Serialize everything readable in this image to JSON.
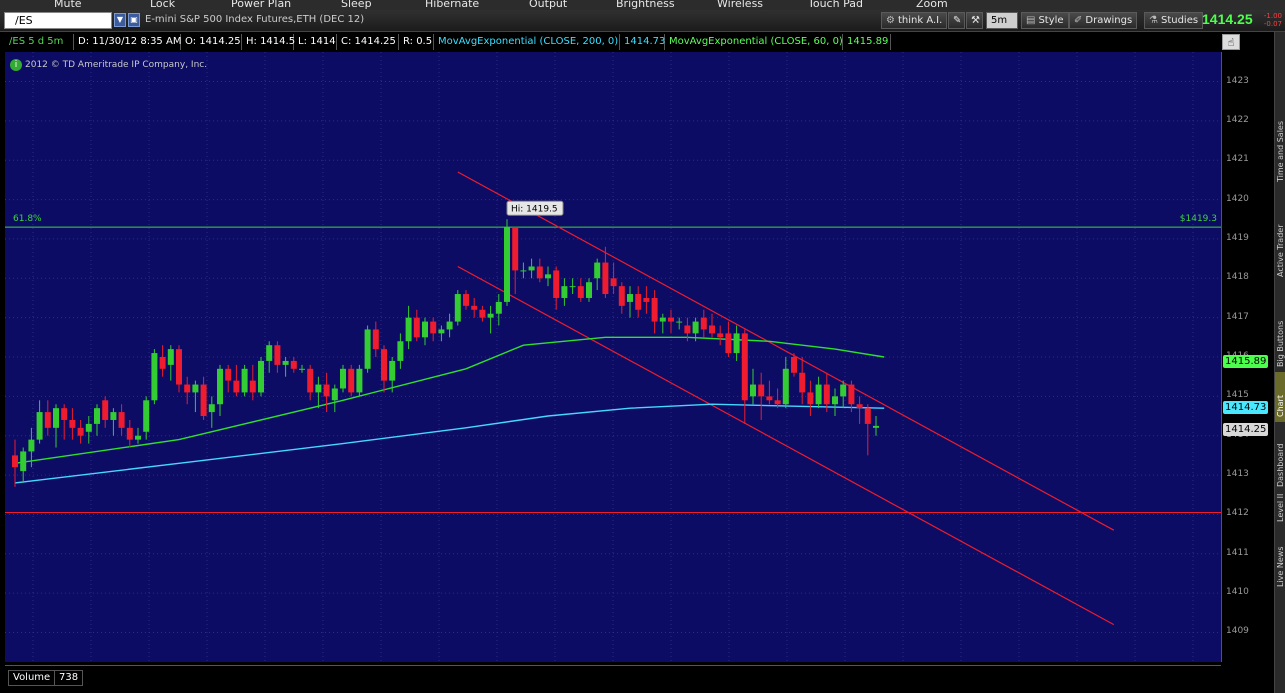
{
  "media_keys": [
    "Mute",
    "Lock",
    "Power Plan",
    "Sleep",
    "Hibernate",
    "Output",
    "Brightness",
    "Wireless",
    "Touch Pad",
    "Zoom"
  ],
  "toolbar": {
    "symbol": "/ES",
    "description": "E-mini S&P 500 Index Futures,ETH (DEC 12)",
    "think_ai": "think A.I.",
    "timeframe": "5m",
    "style": "Style",
    "drawings": "Drawings",
    "studies": "Studies",
    "last_price": "1414.25",
    "change_top": "-1.00",
    "change_bottom": "-0.07"
  },
  "legend": {
    "symbol": "/ES 5 d 5m",
    "date": "D: 11/30/12 8:35 AM",
    "open": "O: 1414.25",
    "high": "H: 1414.5",
    "low": "L: 1414",
    "close": "C: 1414.25",
    "range": "R: 0.5",
    "ema200_label": "MovAvgExponential (CLOSE, 200, 0)",
    "ema200_value": "1414.73",
    "ema60_label": "MovAvgExponential (CLOSE, 60, 0)",
    "ema60_value": "1415.89"
  },
  "copyright": "2012 © TD Ameritrade IP Company, Inc.",
  "fib": {
    "label": "61.8%",
    "price_label": "$1419.3",
    "price": 1419.3
  },
  "hi_label": "Hi: 1419.5",
  "support_line": 1412.05,
  "y_axis_labels": [
    "1423",
    "1422",
    "1421",
    "1420",
    "1419",
    "1418",
    "1417",
    "1416",
    "1415",
    "1414",
    "1413",
    "1412",
    "1411",
    "1410",
    "1409"
  ],
  "price_tags": {
    "ema60": "1415.89",
    "ema200": "1414.73",
    "last": "1414.25"
  },
  "side_tabs": [
    "Time and Sales",
    "Active Trader",
    "Big Buttons",
    "Chart",
    "Dashboard",
    "Level II",
    "Live News"
  ],
  "volume": {
    "label": "Volume",
    "value": "738"
  },
  "colors": {
    "background": "#0c0c64",
    "up": "#33cc33",
    "down": "#ee1c2e",
    "ema60": "#2ee02e",
    "ema200": "#45d8ff",
    "channel": "#ee1c2e"
  },
  "chart_data": {
    "type": "candlestick",
    "ylim": [
      1408.25,
      1423.75
    ],
    "interval": "5m",
    "candles": [
      {
        "o": 1413.5,
        "h": 1413.9,
        "l": 1412.7,
        "c": 1413.2
      },
      {
        "o": 1413.1,
        "h": 1413.7,
        "l": 1412.8,
        "c": 1413.6
      },
      {
        "o": 1413.6,
        "h": 1414.2,
        "l": 1413.2,
        "c": 1413.9
      },
      {
        "o": 1413.9,
        "h": 1414.9,
        "l": 1413.8,
        "c": 1414.6
      },
      {
        "o": 1414.6,
        "h": 1414.9,
        "l": 1414.0,
        "c": 1414.2
      },
      {
        "o": 1414.2,
        "h": 1414.8,
        "l": 1413.7,
        "c": 1414.7
      },
      {
        "o": 1414.7,
        "h": 1414.8,
        "l": 1413.9,
        "c": 1414.4
      },
      {
        "o": 1414.4,
        "h": 1414.7,
        "l": 1413.9,
        "c": 1414.2
      },
      {
        "o": 1414.2,
        "h": 1414.4,
        "l": 1413.8,
        "c": 1414.0
      },
      {
        "o": 1414.1,
        "h": 1414.5,
        "l": 1413.8,
        "c": 1414.3
      },
      {
        "o": 1414.3,
        "h": 1414.8,
        "l": 1414.0,
        "c": 1414.7
      },
      {
        "o": 1414.9,
        "h": 1415.0,
        "l": 1414.2,
        "c": 1414.4
      },
      {
        "o": 1414.4,
        "h": 1414.7,
        "l": 1414.0,
        "c": 1414.6
      },
      {
        "o": 1414.6,
        "h": 1414.8,
        "l": 1414.0,
        "c": 1414.2
      },
      {
        "o": 1414.2,
        "h": 1414.4,
        "l": 1413.7,
        "c": 1413.9
      },
      {
        "o": 1413.9,
        "h": 1414.2,
        "l": 1413.8,
        "c": 1414.0
      },
      {
        "o": 1414.1,
        "h": 1415.0,
        "l": 1413.9,
        "c": 1414.9
      },
      {
        "o": 1414.9,
        "h": 1416.2,
        "l": 1414.8,
        "c": 1416.1
      },
      {
        "o": 1416.0,
        "h": 1416.3,
        "l": 1415.5,
        "c": 1415.7
      },
      {
        "o": 1415.8,
        "h": 1416.3,
        "l": 1415.4,
        "c": 1416.2
      },
      {
        "o": 1416.2,
        "h": 1416.3,
        "l": 1415.1,
        "c": 1415.3
      },
      {
        "o": 1415.3,
        "h": 1415.5,
        "l": 1414.8,
        "c": 1415.1
      },
      {
        "o": 1415.1,
        "h": 1415.4,
        "l": 1414.6,
        "c": 1415.3
      },
      {
        "o": 1415.3,
        "h": 1415.5,
        "l": 1414.4,
        "c": 1414.5
      },
      {
        "o": 1414.6,
        "h": 1415.0,
        "l": 1414.2,
        "c": 1414.8
      },
      {
        "o": 1414.8,
        "h": 1415.8,
        "l": 1414.5,
        "c": 1415.7
      },
      {
        "o": 1415.7,
        "h": 1415.8,
        "l": 1415.1,
        "c": 1415.4
      },
      {
        "o": 1415.4,
        "h": 1415.8,
        "l": 1415.0,
        "c": 1415.1
      },
      {
        "o": 1415.1,
        "h": 1415.8,
        "l": 1415.0,
        "c": 1415.7
      },
      {
        "o": 1415.4,
        "h": 1415.8,
        "l": 1414.9,
        "c": 1415.1
      },
      {
        "o": 1415.1,
        "h": 1416.0,
        "l": 1415.0,
        "c": 1415.9
      },
      {
        "o": 1415.9,
        "h": 1416.4,
        "l": 1415.6,
        "c": 1416.3
      },
      {
        "o": 1416.3,
        "h": 1416.4,
        "l": 1415.6,
        "c": 1415.8
      },
      {
        "o": 1415.8,
        "h": 1416.0,
        "l": 1415.5,
        "c": 1415.9
      },
      {
        "o": 1415.9,
        "h": 1416.0,
        "l": 1415.6,
        "c": 1415.7
      },
      {
        "o": 1415.7,
        "h": 1415.8,
        "l": 1415.6,
        "c": 1415.7
      },
      {
        "o": 1415.7,
        "h": 1415.8,
        "l": 1414.9,
        "c": 1415.1
      },
      {
        "o": 1415.1,
        "h": 1415.5,
        "l": 1414.7,
        "c": 1415.3
      },
      {
        "o": 1415.3,
        "h": 1415.6,
        "l": 1414.6,
        "c": 1415.0
      },
      {
        "o": 1414.9,
        "h": 1415.3,
        "l": 1414.6,
        "c": 1415.2
      },
      {
        "o": 1415.2,
        "h": 1415.8,
        "l": 1415.1,
        "c": 1415.7
      },
      {
        "o": 1415.7,
        "h": 1415.8,
        "l": 1415.0,
        "c": 1415.1
      },
      {
        "o": 1415.1,
        "h": 1415.8,
        "l": 1415.0,
        "c": 1415.7
      },
      {
        "o": 1415.7,
        "h": 1416.8,
        "l": 1415.6,
        "c": 1416.7
      },
      {
        "o": 1416.7,
        "h": 1416.9,
        "l": 1416.0,
        "c": 1416.2
      },
      {
        "o": 1416.2,
        "h": 1416.3,
        "l": 1415.1,
        "c": 1415.4
      },
      {
        "o": 1415.4,
        "h": 1416.0,
        "l": 1415.1,
        "c": 1415.9
      },
      {
        "o": 1415.9,
        "h": 1416.6,
        "l": 1415.7,
        "c": 1416.4
      },
      {
        "o": 1416.4,
        "h": 1417.3,
        "l": 1416.2,
        "c": 1417.0
      },
      {
        "o": 1417.0,
        "h": 1417.2,
        "l": 1416.4,
        "c": 1416.5
      },
      {
        "o": 1416.5,
        "h": 1417.0,
        "l": 1416.3,
        "c": 1416.9
      },
      {
        "o": 1416.9,
        "h": 1417.0,
        "l": 1416.4,
        "c": 1416.6
      },
      {
        "o": 1416.6,
        "h": 1416.8,
        "l": 1416.4,
        "c": 1416.7
      },
      {
        "o": 1416.7,
        "h": 1417.1,
        "l": 1416.5,
        "c": 1416.9
      },
      {
        "o": 1416.9,
        "h": 1417.7,
        "l": 1416.8,
        "c": 1417.6
      },
      {
        "o": 1417.6,
        "h": 1417.7,
        "l": 1417.2,
        "c": 1417.3
      },
      {
        "o": 1417.3,
        "h": 1417.5,
        "l": 1417.0,
        "c": 1417.2
      },
      {
        "o": 1417.2,
        "h": 1417.3,
        "l": 1416.9,
        "c": 1417.0
      },
      {
        "o": 1417.0,
        "h": 1417.3,
        "l": 1416.6,
        "c": 1417.1
      },
      {
        "o": 1417.1,
        "h": 1417.6,
        "l": 1416.8,
        "c": 1417.4
      },
      {
        "o": 1417.4,
        "h": 1419.5,
        "l": 1417.3,
        "c": 1419.3
      },
      {
        "o": 1419.3,
        "h": 1419.3,
        "l": 1417.6,
        "c": 1418.2
      },
      {
        "o": 1418.2,
        "h": 1418.4,
        "l": 1418.0,
        "c": 1418.2
      },
      {
        "o": 1418.2,
        "h": 1418.5,
        "l": 1418.0,
        "c": 1418.3
      },
      {
        "o": 1418.3,
        "h": 1418.5,
        "l": 1417.9,
        "c": 1418.0
      },
      {
        "o": 1418.0,
        "h": 1418.3,
        "l": 1417.8,
        "c": 1418.1
      },
      {
        "o": 1418.2,
        "h": 1418.3,
        "l": 1417.2,
        "c": 1417.5
      },
      {
        "o": 1417.5,
        "h": 1418.0,
        "l": 1417.3,
        "c": 1417.8
      },
      {
        "o": 1417.8,
        "h": 1418.0,
        "l": 1417.6,
        "c": 1417.8
      },
      {
        "o": 1417.8,
        "h": 1418.0,
        "l": 1417.4,
        "c": 1417.5
      },
      {
        "o": 1417.5,
        "h": 1418.0,
        "l": 1417.4,
        "c": 1417.9
      },
      {
        "o": 1418.0,
        "h": 1418.5,
        "l": 1417.7,
        "c": 1418.4
      },
      {
        "o": 1418.4,
        "h": 1418.8,
        "l": 1417.5,
        "c": 1417.6
      },
      {
        "o": 1418.0,
        "h": 1418.4,
        "l": 1417.6,
        "c": 1417.8
      },
      {
        "o": 1417.8,
        "h": 1417.9,
        "l": 1417.1,
        "c": 1417.3
      },
      {
        "o": 1417.4,
        "h": 1417.8,
        "l": 1417.0,
        "c": 1417.6
      },
      {
        "o": 1417.6,
        "h": 1417.8,
        "l": 1417.0,
        "c": 1417.2
      },
      {
        "o": 1417.5,
        "h": 1417.8,
        "l": 1417.1,
        "c": 1417.4
      },
      {
        "o": 1417.5,
        "h": 1417.7,
        "l": 1416.6,
        "c": 1416.9
      },
      {
        "o": 1416.9,
        "h": 1417.1,
        "l": 1416.6,
        "c": 1417.0
      },
      {
        "o": 1417.0,
        "h": 1417.2,
        "l": 1416.6,
        "c": 1416.9
      },
      {
        "o": 1416.9,
        "h": 1417.0,
        "l": 1416.7,
        "c": 1416.9
      },
      {
        "o": 1416.8,
        "h": 1417.0,
        "l": 1416.4,
        "c": 1416.6
      },
      {
        "o": 1416.6,
        "h": 1417.0,
        "l": 1416.4,
        "c": 1416.9
      },
      {
        "o": 1417.0,
        "h": 1417.2,
        "l": 1416.5,
        "c": 1416.7
      },
      {
        "o": 1416.8,
        "h": 1417.1,
        "l": 1416.5,
        "c": 1416.6
      },
      {
        "o": 1416.6,
        "h": 1416.8,
        "l": 1416.3,
        "c": 1416.5
      },
      {
        "o": 1416.6,
        "h": 1416.9,
        "l": 1416.0,
        "c": 1416.1
      },
      {
        "o": 1416.1,
        "h": 1416.8,
        "l": 1415.9,
        "c": 1416.6
      },
      {
        "o": 1416.6,
        "h": 1416.7,
        "l": 1414.3,
        "c": 1414.9
      },
      {
        "o": 1415.0,
        "h": 1415.7,
        "l": 1414.8,
        "c": 1415.3
      },
      {
        "o": 1415.3,
        "h": 1415.6,
        "l": 1414.4,
        "c": 1415.0
      },
      {
        "o": 1415.0,
        "h": 1415.4,
        "l": 1414.8,
        "c": 1414.9
      },
      {
        "o": 1414.9,
        "h": 1415.2,
        "l": 1414.7,
        "c": 1414.8
      },
      {
        "o": 1414.8,
        "h": 1416.0,
        "l": 1414.7,
        "c": 1415.7
      },
      {
        "o": 1416.0,
        "h": 1416.1,
        "l": 1415.5,
        "c": 1415.6
      },
      {
        "o": 1415.6,
        "h": 1416.0,
        "l": 1414.8,
        "c": 1415.1
      },
      {
        "o": 1415.1,
        "h": 1415.4,
        "l": 1414.5,
        "c": 1414.8
      },
      {
        "o": 1414.8,
        "h": 1415.5,
        "l": 1414.7,
        "c": 1415.3
      },
      {
        "o": 1415.3,
        "h": 1415.6,
        "l": 1414.6,
        "c": 1414.8
      },
      {
        "o": 1414.8,
        "h": 1415.2,
        "l": 1414.5,
        "c": 1415.0
      },
      {
        "o": 1415.0,
        "h": 1415.4,
        "l": 1414.7,
        "c": 1415.3
      },
      {
        "o": 1415.3,
        "h": 1415.4,
        "l": 1414.6,
        "c": 1414.8
      },
      {
        "o": 1414.8,
        "h": 1415.0,
        "l": 1414.3,
        "c": 1414.7
      },
      {
        "o": 1414.7,
        "h": 1414.8,
        "l": 1413.5,
        "c": 1414.3
      },
      {
        "o": 1414.2,
        "h": 1414.5,
        "l": 1414.0,
        "c": 1414.25
      }
    ],
    "ema60": [
      [
        0,
        1413.3
      ],
      [
        20,
        1413.9
      ],
      [
        40,
        1414.9
      ],
      [
        55,
        1415.7
      ],
      [
        62,
        1416.3
      ],
      [
        72,
        1416.5
      ],
      [
        82,
        1416.5
      ],
      [
        92,
        1416.4
      ],
      [
        100,
        1416.2
      ],
      [
        106,
        1416.0
      ]
    ],
    "ema200": [
      [
        0,
        1412.8
      ],
      [
        20,
        1413.3
      ],
      [
        40,
        1413.8
      ],
      [
        55,
        1414.2
      ],
      [
        65,
        1414.5
      ],
      [
        75,
        1414.7
      ],
      [
        85,
        1414.8
      ],
      [
        95,
        1414.75
      ],
      [
        106,
        1414.7
      ]
    ],
    "channel_upper": [
      [
        54,
        1420.7
      ],
      [
        134,
        1411.6
      ]
    ],
    "channel_lower": [
      [
        54,
        1418.3
      ],
      [
        134,
        1409.2
      ]
    ]
  }
}
